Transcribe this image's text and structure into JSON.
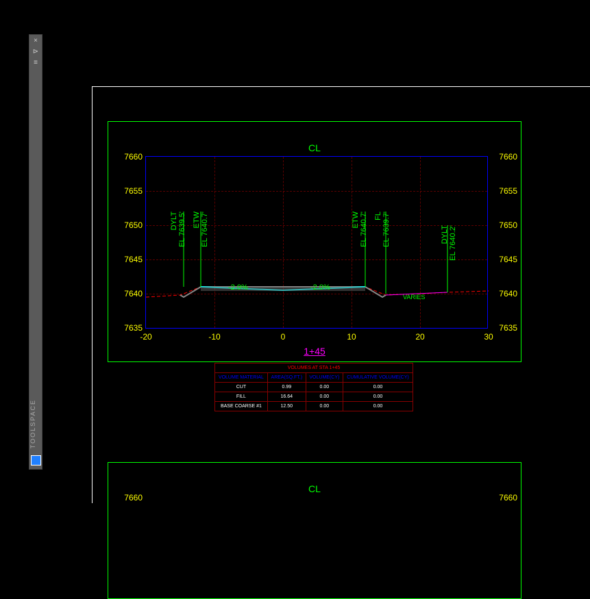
{
  "toolspace": {
    "label": "TOOLSPACE"
  },
  "section1": {
    "cl": "CL",
    "station": "1+45",
    "y_ticks": [
      "7660",
      "7655",
      "7650",
      "7645",
      "7640",
      "7635"
    ],
    "x_ticks": [
      "-20",
      "-10",
      "0",
      "10",
      "20",
      "30"
    ],
    "labels": {
      "dylt_l": "DYLT",
      "el_dylt_l": "EL 7639.5'",
      "etw_l": "ETW",
      "el_etw_l": "EL 7640.7'",
      "etw_r": "ETW",
      "el_etw_r": "EL 7640.7'",
      "fl": "FL",
      "el_fl": "EL 7639.7'",
      "dylt_r": "DYLT",
      "el_dylt_r": "EL 7640.2'"
    },
    "slope_l": "-2.0%",
    "slope_r": "-2.0%",
    "varies": "VARIES"
  },
  "volume_table": {
    "title": "VOLUMES AT STA 1+45",
    "headers": [
      "VOLUME MATERIAL",
      "AREA(SQ.FT.)",
      "VOLUME(CY)",
      "CUMULATIVE VOLUME(CY)"
    ],
    "rows": [
      {
        "mat": "CUT",
        "area": "0.99",
        "vol": "0.00",
        "cum": "0.00"
      },
      {
        "mat": "FILL",
        "area": "16.64",
        "vol": "0.00",
        "cum": "0.00"
      },
      {
        "mat": "BASE COARSE #1",
        "area": "12.50",
        "vol": "0.00",
        "cum": "0.00"
      }
    ]
  },
  "section2": {
    "cl": "CL",
    "y0": "7660"
  },
  "chart_data": {
    "type": "cross-section",
    "station": "1+45",
    "x_range": [
      -20,
      30
    ],
    "y_range": [
      7635,
      7660
    ],
    "points": [
      {
        "name": "DYLT",
        "offset": -15,
        "elev": 7639.5
      },
      {
        "name": "ETW",
        "offset": -12,
        "elev": 7640.7
      },
      {
        "name": "CL",
        "offset": 0,
        "elev": 7641.0
      },
      {
        "name": "ETW",
        "offset": 12,
        "elev": 7640.7
      },
      {
        "name": "FL",
        "offset": 15,
        "elev": 7639.7
      },
      {
        "name": "DYLT",
        "offset": 24,
        "elev": 7640.2
      }
    ],
    "slopes": [
      {
        "side": "left",
        "value": -2.0
      },
      {
        "side": "right",
        "value": -2.0
      },
      {
        "side": "far-right",
        "value": "varies"
      }
    ]
  }
}
